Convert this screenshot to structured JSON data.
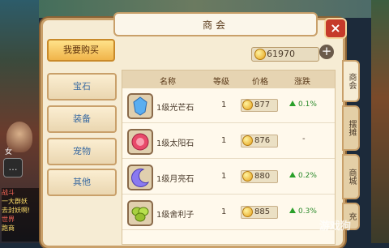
{
  "header": {
    "title": "商会",
    "close_label": "×"
  },
  "buy_button": "我要购买",
  "currency": {
    "amount": "61970",
    "add_label": "+"
  },
  "categories": [
    "宝石",
    "装备",
    "宠物",
    "其他"
  ],
  "table": {
    "columns": [
      "名称",
      "等级",
      "价格",
      "涨跌"
    ],
    "rows": [
      {
        "name": "1级光芒石",
        "level": "1",
        "price": "877",
        "change": "0.1%",
        "trend": "up"
      },
      {
        "name": "1级太阳石",
        "level": "1",
        "price": "876",
        "change": "-",
        "trend": "flat"
      },
      {
        "name": "1级月亮石",
        "level": "1",
        "price": "880",
        "change": "0.2%",
        "trend": "up"
      },
      {
        "name": "1级舍利子",
        "level": "1",
        "price": "885",
        "change": "0.3%",
        "trend": "up"
      }
    ]
  },
  "side_tabs": [
    "商会",
    "摆摊",
    "商城",
    "充"
  ],
  "chat": [
    "战斗",
    "一大群妖",
    "去封妖啊!",
    "世界",
    "跑商"
  ],
  "character_name": "女",
  "watermark": "游戏狗"
}
